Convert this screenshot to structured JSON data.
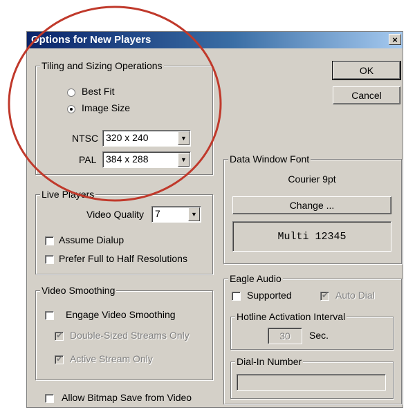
{
  "window": {
    "title": "Options for New Players",
    "close_glyph": "×"
  },
  "buttons": {
    "ok": "OK",
    "cancel": "Cancel"
  },
  "tiling": {
    "legend": "Tiling and Sizing Operations",
    "best_fit": "Best Fit",
    "image_size": "Image Size",
    "selected": "Image Size",
    "ntsc_label": "NTSC",
    "ntsc_value": "320 x 240",
    "pal_label": "PAL",
    "pal_value": "384 x 288"
  },
  "live_players": {
    "legend": "Live Players",
    "video_quality_label": "Video Quality",
    "video_quality_value": "7",
    "assume_dialup": "Assume Dialup",
    "prefer_full": "Prefer Full to Half Resolutions"
  },
  "video_smoothing": {
    "legend": "Video Smoothing",
    "engage": "Engage Video Smoothing",
    "double_sized": "Double-Sized Streams Only",
    "active_stream": "Active Stream Only"
  },
  "allow_bitmap": "Allow Bitmap Save from Video",
  "data_window_font": {
    "legend": "Data Window Font",
    "font_name": "Courier 9pt",
    "change_button": "Change ...",
    "preview": "Multi 12345"
  },
  "eagle_audio": {
    "legend": "Eagle Audio",
    "supported": "Supported",
    "auto_dial": "Auto Dial",
    "hotline_legend": "Hotline Activation Interval",
    "hotline_value": "30",
    "hotline_unit": "Sec.",
    "dialin_legend": "Dial-In Number",
    "dialin_value": ""
  },
  "annotation_color": "#c0392b"
}
